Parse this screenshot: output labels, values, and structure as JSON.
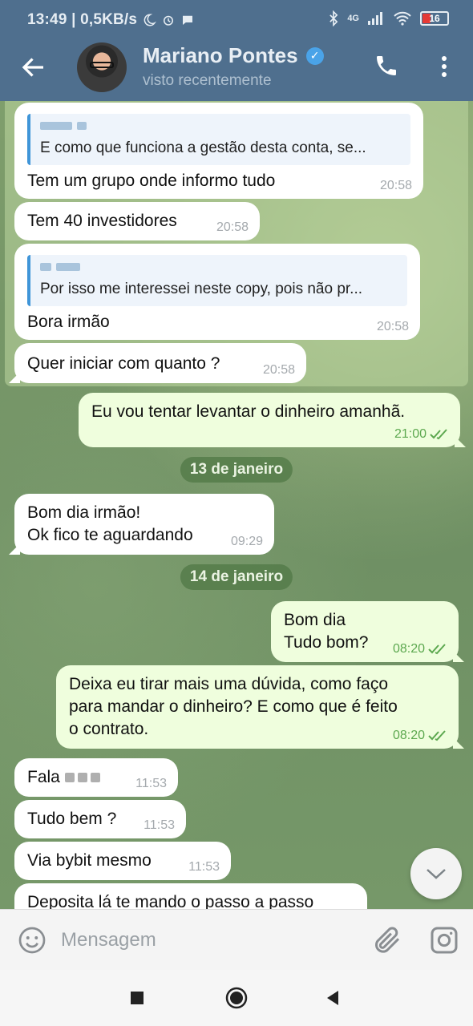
{
  "status_bar": {
    "time_speed": "13:49 | 0,5KB/s",
    "network": "4G",
    "battery": "16"
  },
  "header": {
    "contact_name": "Mariano Pontes",
    "status": "visto recentemente"
  },
  "messages": [
    {
      "reply_text": "E como que funciona a gestão desta conta, se...",
      "text": "Tem um grupo onde informo tudo",
      "time": "20:58"
    },
    {
      "text": "Tem 40 investidores",
      "time": "20:58"
    },
    {
      "reply_text": "Por isso me interessei neste copy, pois não pr...",
      "text": "Bora irmão",
      "time": "20:58"
    },
    {
      "text": "Quer iniciar com quanto ?",
      "time": "20:58"
    },
    {
      "text": "Eu vou tentar levantar o dinheiro amanhã.",
      "time": "21:00"
    },
    {
      "text_line1": "Bom dia irmão!",
      "text_line2": "Ok fico te aguardando",
      "time": "09:29"
    },
    {
      "text_line1": "Bom dia",
      "text_line2": "Tudo bom?",
      "time": "08:20"
    },
    {
      "text_line1": "Deixa eu tirar mais uma dúvida, como faço",
      "text_line2": "para mandar o dinheiro? E como que é feito",
      "text_line3": "o contrato.",
      "time": "08:20"
    },
    {
      "text": "Fala",
      "time": "11:53"
    },
    {
      "text": "Tudo bem ?",
      "time": "11:53"
    },
    {
      "text": "Via bybit mesmo",
      "time": "11:53"
    },
    {
      "text": "Deposita lá te mando o passo a passo"
    }
  ],
  "dates": {
    "first": "13 de janeiro",
    "second": "14 de janeiro"
  },
  "input": {
    "placeholder": "Mensagem"
  },
  "colors": {
    "header_bg": "#4f6f8e",
    "outgoing_bubble": "#effedd",
    "incoming_bubble": "#ffffff",
    "read_checks": "#5ca84f",
    "reply_accent": "#3f95d8"
  }
}
